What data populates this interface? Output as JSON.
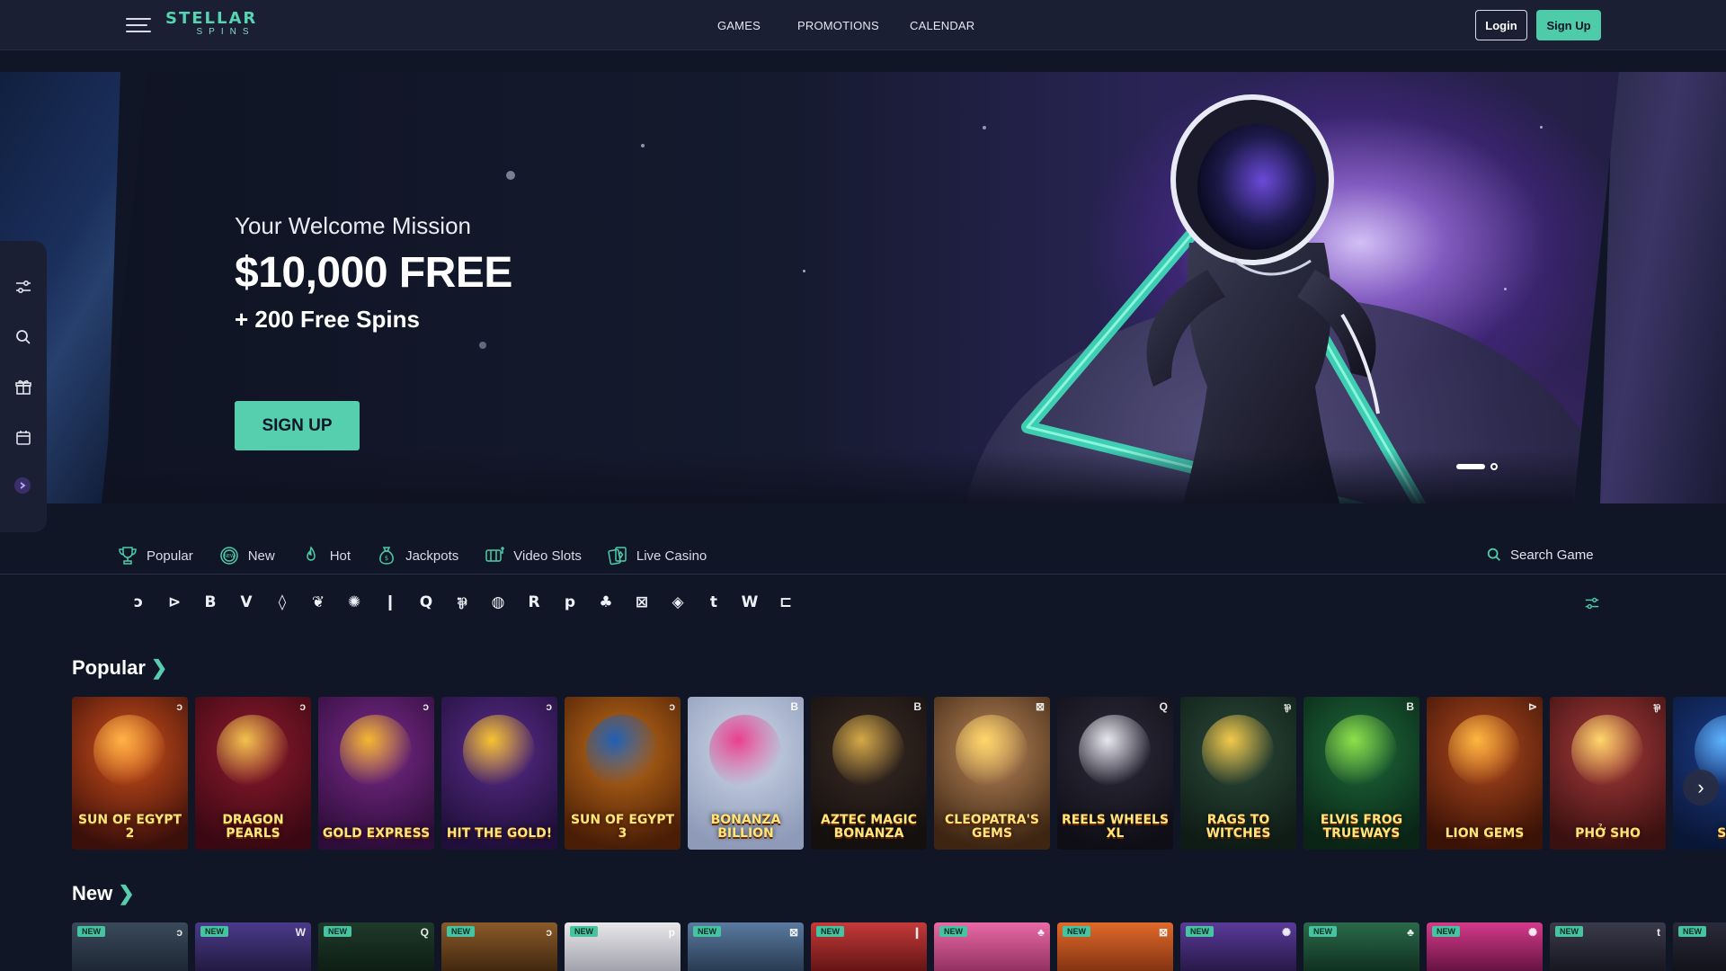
{
  "header": {
    "logo_main": "STELLAR",
    "logo_sub": "SPINS",
    "nav": [
      "GAMES",
      "PROMOTIONS",
      "CALENDAR"
    ],
    "login_label": "Login",
    "signup_label": "Sign Up"
  },
  "hero": {
    "subtitle": "Your Welcome Mission",
    "title": "$10,000 FREE",
    "offer": "+ 200 Free Spins",
    "cta_label": "SIGN UP"
  },
  "sidebar": {
    "icons": [
      "sliders-icon",
      "search-icon",
      "gift-icon",
      "calendar-icon",
      "chevron-right-icon"
    ]
  },
  "categories": {
    "tabs": [
      {
        "label": "Popular",
        "icon": "trophy-icon"
      },
      {
        "label": "New",
        "icon": "new-badge-icon"
      },
      {
        "label": "Hot",
        "icon": "flame-icon"
      },
      {
        "label": "Jackpots",
        "icon": "money-bag-icon"
      },
      {
        "label": "Video Slots",
        "icon": "slot-machine-icon"
      },
      {
        "label": "Live Casino",
        "icon": "cards-icon"
      }
    ],
    "search_label": "Search Game"
  },
  "providers": [
    "ↄ",
    "⊳",
    "B",
    "V",
    "◊",
    "❦",
    "✺",
    "❙",
    "Q",
    "⅌",
    "◍",
    "R",
    "p",
    "♣",
    "⊠",
    "◈",
    "t",
    "W",
    "⊏"
  ],
  "sections": {
    "popular_title": "Popular",
    "new_title": "New",
    "chevron": "❯"
  },
  "popular_games": [
    {
      "name": "SUN OF EGYPT 2",
      "badge": "ↄ",
      "bg1": "#d0501b",
      "bg2": "#3b0f0a",
      "accent": "#ffb347"
    },
    {
      "name": "DRAGON PEARLS",
      "badge": "ↄ",
      "bg1": "#8e1a2e",
      "bg2": "#3a0812",
      "accent": "#f2c14e"
    },
    {
      "name": "GOLD EXPRESS",
      "badge": "ↄ",
      "bg1": "#7a2a8a",
      "bg2": "#2e0d3a",
      "accent": "#f5b731"
    },
    {
      "name": "HIT THE GOLD!",
      "badge": "ↄ",
      "bg1": "#5b2c8a",
      "bg2": "#1f0f3a",
      "accent": "#f7c331"
    },
    {
      "name": "SUN OF EGYPT 3",
      "badge": "ↄ",
      "bg1": "#c4701a",
      "bg2": "#4a1d06",
      "accent": "#1f5fb5"
    },
    {
      "name": "BONANZA BILLION",
      "badge": "B",
      "bg1": "#cfd8ea",
      "bg2": "#8e9ab8",
      "accent": "#e83f8f"
    },
    {
      "name": "AZTEC MAGIC BONANZA",
      "badge": "B",
      "bg1": "#3a2a24",
      "bg2": "#14100e",
      "accent": "#d4a948"
    },
    {
      "name": "CLEOPATRA'S GEMS",
      "badge": "⊠",
      "bg1": "#b8865a",
      "bg2": "#3d2512",
      "accent": "#ffd66b"
    },
    {
      "name": "REELS WHEELS XL",
      "badge": "Q",
      "bg1": "#2e2b3a",
      "bg2": "#0f0e16",
      "accent": "#e8e8f0"
    },
    {
      "name": "RAGS TO WITCHES",
      "badge": "⅌",
      "bg1": "#2c4a3a",
      "bg2": "#0f1c16",
      "accent": "#f2c94c"
    },
    {
      "name": "ELVIS FROG TRUEWAYS",
      "badge": "B",
      "bg1": "#1d6a3a",
      "bg2": "#0a2416",
      "accent": "#8fe04a"
    },
    {
      "name": "LION GEMS",
      "badge": "⊳",
      "bg1": "#b24a1e",
      "bg2": "#3a1206",
      "accent": "#ffb640"
    },
    {
      "name": "PHỞ SHO",
      "badge": "⅌",
      "bg1": "#a83a3a",
      "bg2": "#3a1010",
      "accent": "#ffd66b"
    },
    {
      "name": "STR",
      "badge": "",
      "bg1": "#1b3d8a",
      "bg2": "#0a1636",
      "accent": "#5fb3ff"
    }
  ],
  "new_games": [
    {
      "badge": "ↄ",
      "bg1": "#3a4a5a",
      "bg2": "#1a2230"
    },
    {
      "badge": "W",
      "bg1": "#4a3a8a",
      "bg2": "#1f173a"
    },
    {
      "badge": "Q",
      "bg1": "#1f3a2a",
      "bg2": "#0c1a12"
    },
    {
      "badge": "ↄ",
      "bg1": "#8a5a2a",
      "bg2": "#3a220c"
    },
    {
      "badge": "p",
      "bg1": "#e8e8ea",
      "bg2": "#9a9aa6"
    },
    {
      "badge": "⊠",
      "bg1": "#5a7aa0",
      "bg2": "#24344a"
    },
    {
      "badge": "❙",
      "bg1": "#c43a3a",
      "bg2": "#5a1010"
    },
    {
      "badge": "♣",
      "bg1": "#e86aa6",
      "bg2": "#8a2a5a"
    },
    {
      "badge": "⊠",
      "bg1": "#e06a2a",
      "bg2": "#7a2e10"
    },
    {
      "badge": "✺",
      "bg1": "#5a3a9a",
      "bg2": "#23153f"
    },
    {
      "badge": "♣",
      "bg1": "#2a6a4a",
      "bg2": "#0e2a1c"
    },
    {
      "badge": "✺",
      "bg1": "#d43a8a",
      "bg2": "#5a0f3a"
    },
    {
      "badge": "t",
      "bg1": "#3a3a4a",
      "bg2": "#14141e"
    },
    {
      "badge": "",
      "bg1": "#2a2a3a",
      "bg2": "#101018"
    }
  ],
  "new_badge_label": "NEW",
  "colors": {
    "accent": "#4ecba9",
    "background": "#111627",
    "header": "#1a1f33"
  }
}
